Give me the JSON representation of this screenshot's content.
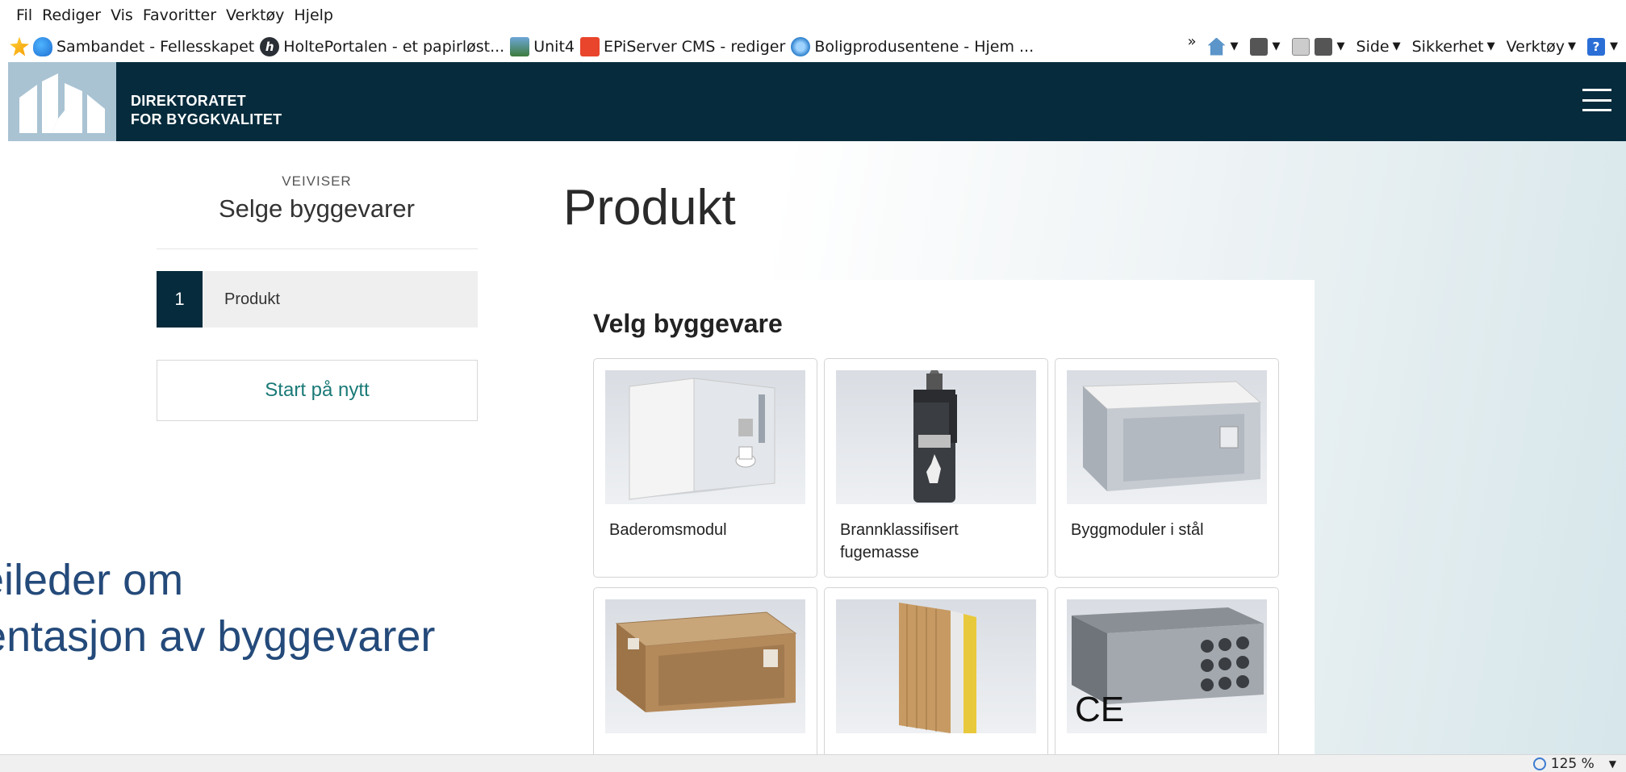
{
  "browser": {
    "menu": [
      "Fil",
      "Rediger",
      "Vis",
      "Favoritter",
      "Verktøy",
      "Hjelp"
    ],
    "favorites": [
      {
        "label": "Sambandet - Fellesskapet",
        "icon": "cloud-icon"
      },
      {
        "label": "HoltePortalen - et papirløst...",
        "icon": "holte-icon"
      },
      {
        "label": "Unit4",
        "icon": "unit4-icon"
      },
      {
        "label": "EPiServer CMS - rediger",
        "icon": "episerver-icon"
      },
      {
        "label": "Boligprodusentene - Hjem ...",
        "icon": "ie-page-icon"
      }
    ],
    "toolbar": {
      "overflow": "»",
      "side": "Side",
      "sikkerhet": "Sikkerhet",
      "verktoy": "Verktøy",
      "help_glyph": "?"
    },
    "zoom": "125 %"
  },
  "site": {
    "org_line1": "DIREKTORATET",
    "org_line2": "FOR BYGGKVALITET"
  },
  "guide": {
    "kicker": "VEIVISER",
    "title": "Selge byggevarer",
    "step_number": "1",
    "step_label": "Produkt",
    "restart": "Start på nytt"
  },
  "main": {
    "page_title": "Produkt",
    "panel_title": "Velg byggevare",
    "products": [
      {
        "name": "Baderomsmodul",
        "image": "bathroom-module"
      },
      {
        "name": "Brannklassifisert fugemasse",
        "image": "sealant-tube"
      },
      {
        "name": "Byggmoduler i stål",
        "image": "steel-module"
      },
      {
        "name": "",
        "image": "wood-module"
      },
      {
        "name": "",
        "image": "wall-element"
      },
      {
        "name": "",
        "image": "hollowcore-slab",
        "badge": "CE"
      }
    ]
  },
  "background_text": {
    "line1": "veileder om",
    "line2": "nentasjon av byggevarer"
  },
  "colors": {
    "header_bg": "#062b3c",
    "accent_teal": "#1a7a77",
    "logo_bg": "#a9c3d3",
    "bg_text": "#244a7a"
  }
}
